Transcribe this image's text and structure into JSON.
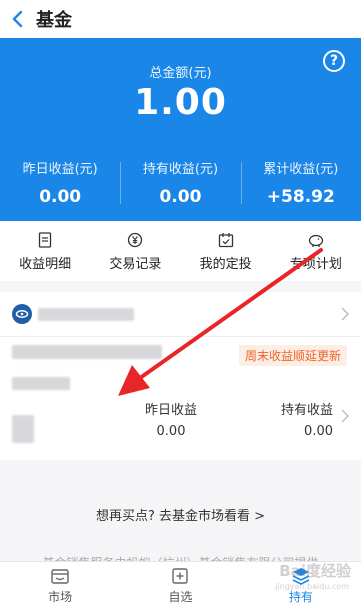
{
  "header": {
    "title": "基金"
  },
  "summary": {
    "total_label": "总金额(元)",
    "total_value": "1.00",
    "help": "?",
    "stats": [
      {
        "label": "昨日收益(元)",
        "value": "0.00"
      },
      {
        "label": "持有收益(元)",
        "value": "0.00"
      },
      {
        "label": "累计收益(元)",
        "value": "+58.92"
      }
    ]
  },
  "quicknav": [
    {
      "label": "收益明细",
      "icon": "document-icon"
    },
    {
      "label": "交易记录",
      "icon": "yen-coin-icon"
    },
    {
      "label": "我的定投",
      "icon": "calendar-icon"
    },
    {
      "label": "专项计划",
      "icon": "piggy-bank-icon"
    }
  ],
  "fund_card": {
    "badge": "周末收益顺延更新",
    "metrics": [
      {
        "label": "昨日收益",
        "value": "0.00"
      },
      {
        "label": "持有收益",
        "value": "0.00"
      }
    ]
  },
  "more_link": "想再买点? 去基金市场看看 >",
  "footer_note": "基金销售服务由蚂蚁（杭州）基金销售有限公司提供",
  "bottom_nav": [
    {
      "label": "市场",
      "icon": "market-icon"
    },
    {
      "label": "自选",
      "icon": "add-square-icon"
    },
    {
      "label": "持有",
      "icon": "holdings-icon"
    }
  ],
  "watermark": {
    "main": "Bai度经验",
    "sub": "jingyan.baidu.com"
  },
  "colors": {
    "primary": "#1a87e8",
    "badge_text": "#f0642a",
    "annotation_arrow": "#e8262a"
  }
}
